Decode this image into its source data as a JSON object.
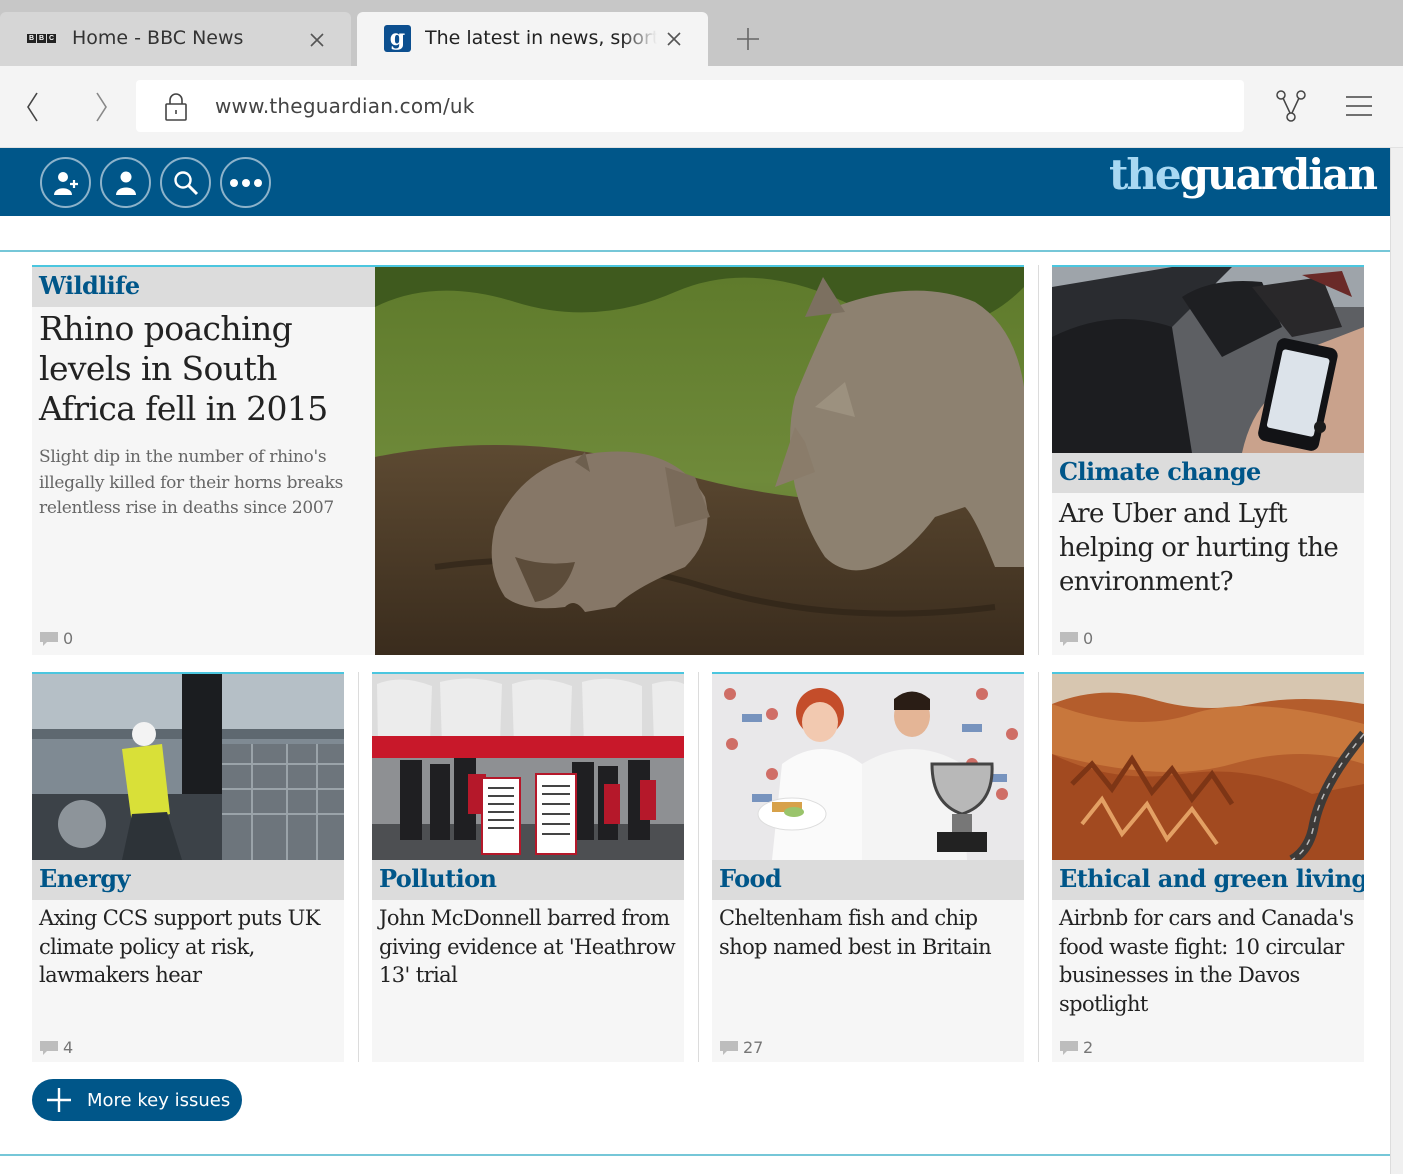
{
  "browser": {
    "tabs": [
      {
        "title": "Home - BBC News",
        "favicon": "bbc-favicon"
      },
      {
        "title": "The latest in news, sports and opinion",
        "favicon": "guardian-favicon"
      }
    ],
    "url": "www.theguardian.com/uk"
  },
  "guardian": {
    "logo_the": "the",
    "logo_guardian": "guardian",
    "brand_color": "#005689",
    "header_icons": [
      "add-user-icon",
      "user-icon",
      "search-icon",
      "more-icon"
    ]
  },
  "lead": {
    "kicker": "Wildlife",
    "headline": "Rhino poaching levels in South Africa fell in 2015",
    "standfirst": "Slight dip in the number of rhino's illegally killed for their horns breaks relentless rise in deaths since 2007",
    "comments": "0"
  },
  "side": {
    "kicker": "Climate change",
    "headline": "Are Uber and Lyft helping or hurting the environment?",
    "comments": "0"
  },
  "cards": [
    {
      "kicker": "Energy",
      "headline": "Axing CCS support puts UK climate policy at risk, lawmakers hear",
      "comments": "4"
    },
    {
      "kicker": "Pollution",
      "headline": "John McDonnell barred from giving evidence at 'Heathrow 13' trial",
      "comments": ""
    },
    {
      "kicker": "Food",
      "headline": "Cheltenham fish and chip shop named best in Britain",
      "comments": "27"
    },
    {
      "kicker": "Ethical and green living",
      "headline": "Airbnb for cars and Canada's food waste fight: 10 circular businesses in the Davos spotlight",
      "comments": "2"
    }
  ],
  "protest_signs": {
    "left": "THE 313 RUNWAY COULD BE THE BIGGEST AVIATION RELATED ACCOUNT FOR OVER 4% OF UK GREENHOUSE GAS EMISSIONS",
    "right": "WHERE WILL YOU DRAW YOUR RED LINE? #REDLINES #REDLINESLONDON"
  },
  "more_button": "More key issues"
}
